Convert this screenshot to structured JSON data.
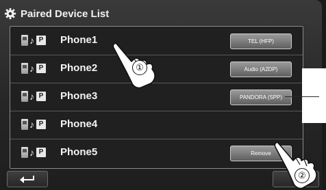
{
  "header": {
    "title": "Paired Device List",
    "icon": "gear-icon"
  },
  "devices": [
    {
      "name": "Phone1",
      "profile": "TEL (HFP)"
    },
    {
      "name": "Phone2",
      "profile": "Audio (A2DP)"
    },
    {
      "name": "Phone3",
      "profile": "PANDORA (SPP)"
    },
    {
      "name": "Phone4",
      "profile": ""
    },
    {
      "name": "Phone5",
      "profile": "Remove"
    }
  ],
  "row_icons": {
    "phone": "phone-icon",
    "music": "♪",
    "p_label": "P"
  },
  "footer": {
    "back_icon": "return-arrow-icon"
  },
  "steps": [
    "①",
    "②"
  ]
}
